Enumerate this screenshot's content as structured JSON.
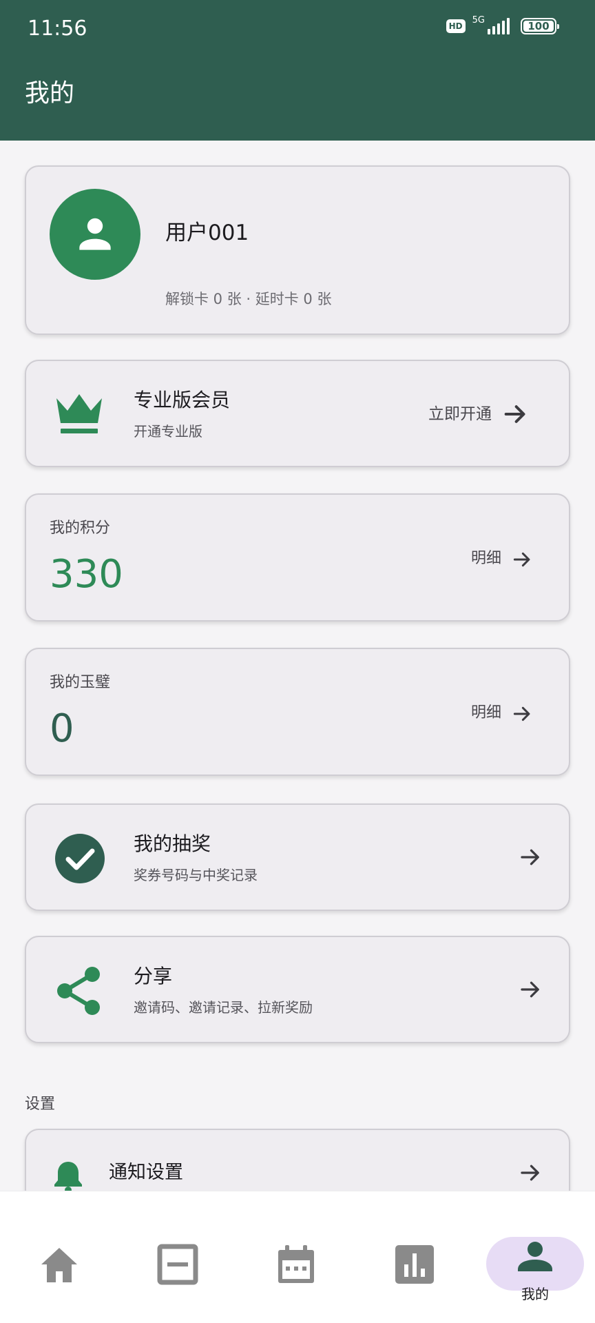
{
  "status_bar": {
    "time": "11:56",
    "hd": "HD",
    "network": "5G",
    "battery": "100",
    "battery_level": 1.0
  },
  "header": {
    "title": "我的"
  },
  "profile": {
    "avatar_icon": "person-icon",
    "name": "用户001",
    "cards_summary": "解锁卡 0 张 · 延时卡 0 张"
  },
  "membership": {
    "icon": "crown-icon",
    "title": "专业版会员",
    "subtitle": "开通专业版",
    "action": "立即开通"
  },
  "points": {
    "label": "我的积分",
    "value": "330",
    "detail": "明细"
  },
  "jade": {
    "label": "我的玉璧",
    "value": "0",
    "detail": "明细"
  },
  "lottery": {
    "icon": "check-circle-icon",
    "title": "我的抽奖",
    "subtitle": "奖券号码与中奖记录"
  },
  "share": {
    "icon": "share-icon",
    "title": "分享",
    "subtitle": "邀请码、邀请记录、拉新奖励"
  },
  "settings": {
    "section_title": "设置",
    "items": [
      {
        "icon": "bell-icon",
        "label": "通知设置"
      }
    ]
  },
  "bottom_nav": {
    "items": [
      {
        "icon": "home-icon"
      },
      {
        "icon": "card-icon"
      },
      {
        "icon": "calendar-icon"
      },
      {
        "icon": "chart-icon"
      },
      {
        "icon": "person-icon",
        "label": "我的",
        "active": true
      }
    ]
  },
  "colors": {
    "header": "#2f5e50",
    "accent_green": "#2e8a57",
    "dark_green": "#2f5e50",
    "card_bg": "#efedf1",
    "nav_active_pill": "#e7dcf5",
    "nav_icon": "#8a8a8a"
  }
}
